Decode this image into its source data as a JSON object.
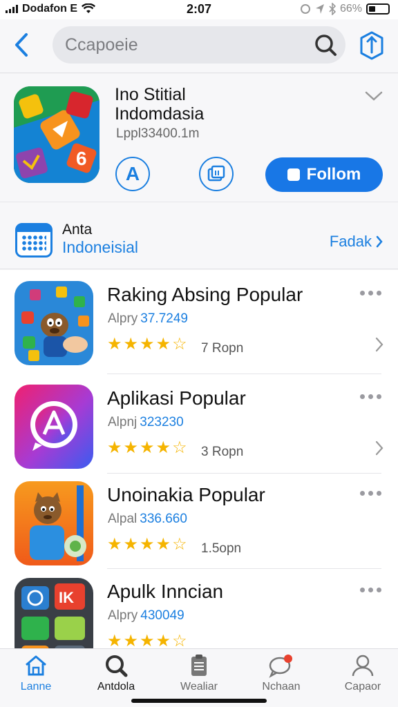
{
  "status_bar": {
    "carrier": "Dodafon E",
    "time": "2:07",
    "battery": "66%"
  },
  "header": {
    "search_placeholder": "Ccapoeie"
  },
  "featured": {
    "title_line1": "Ino Stitial",
    "title_line2": "Indomdasia",
    "subtitle": "Lppl33400.1m",
    "follow_label": "Follom",
    "round_btn1_glyph": "A"
  },
  "region": {
    "label": "Anta",
    "value": "Indoneisial",
    "link_label": "Fadak"
  },
  "apps": [
    {
      "title": "Raking Absing Popular",
      "sub_label": "Alpry",
      "sub_value": "37.7249",
      "rating": 4.5,
      "count": "7 Ropn"
    },
    {
      "title": "Aplikasi Popular",
      "sub_label": "Alpnj",
      "sub_value": "323230",
      "rating": 4.5,
      "count": "3 Ropn"
    },
    {
      "title": "Unoinakia Popular",
      "sub_label": "Alpal",
      "sub_value": "336.660",
      "rating": 4.5,
      "count": "1.5opn"
    },
    {
      "title": "Apulk Inncian",
      "sub_label": "Alpry",
      "sub_value": "430049",
      "rating": 4.5,
      "count": ""
    }
  ],
  "tabbar": {
    "tabs": [
      {
        "label": "Lanne",
        "icon": "home-icon"
      },
      {
        "label": "Antdola",
        "icon": "search-icon"
      },
      {
        "label": "Wealiar",
        "icon": "clipboard-icon"
      },
      {
        "label": "Nchaan",
        "icon": "chat-icon"
      },
      {
        "label": "Capaor",
        "icon": "person-icon"
      }
    ]
  },
  "colors": {
    "accent": "#1b7fe0",
    "star": "#f5b400"
  }
}
